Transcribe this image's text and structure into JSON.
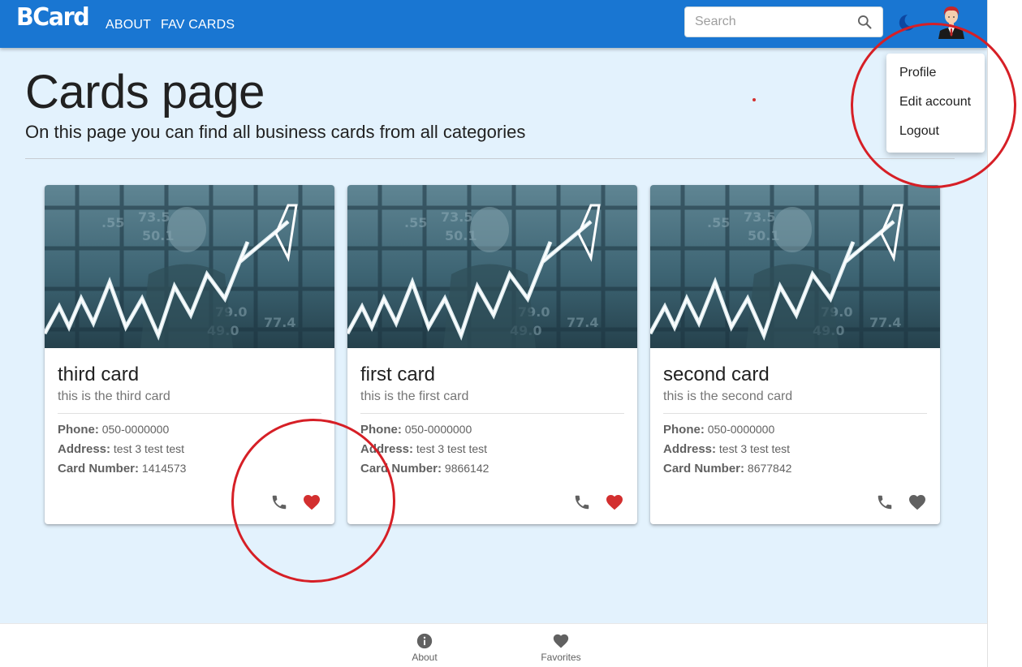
{
  "header": {
    "logo": "BCard",
    "nav": [
      {
        "label": "ABOUT"
      },
      {
        "label": "FAV CARDS"
      }
    ],
    "search_placeholder": "Search",
    "theme_icon": "moon-icon",
    "avatar_icon": "user-avatar"
  },
  "account_menu": {
    "items": [
      {
        "label": "Profile"
      },
      {
        "label": "Edit account"
      },
      {
        "label": "Logout"
      }
    ]
  },
  "page": {
    "title": "Cards page",
    "subtitle": "On this page you can find all business cards from all categories"
  },
  "card_labels": {
    "phone": "Phone:",
    "address": "Address:",
    "card_number": "Card Number:"
  },
  "cards": [
    {
      "title": "third card",
      "subtitle": "this is the third card",
      "phone": "050-0000000",
      "address": "test 3 test test",
      "card_number": "1414573",
      "favorite": true
    },
    {
      "title": "first card",
      "subtitle": "this is the first card",
      "phone": "050-0000000",
      "address": "test 3 test test",
      "card_number": "9866142",
      "favorite": true
    },
    {
      "title": "second card",
      "subtitle": "this is the second card",
      "phone": "050-0000000",
      "address": "test 3 test test",
      "card_number": "8677842",
      "favorite": false
    }
  ],
  "bottom_nav": [
    {
      "label": "About",
      "icon": "info-icon"
    },
    {
      "label": "Favorites",
      "icon": "heart-icon"
    }
  ],
  "colors": {
    "appbar": "#1976d2",
    "background": "#e3f2fd",
    "favorite_active": "#d32f2f",
    "favorite_inactive": "#616161",
    "annotation": "#d61f26"
  }
}
